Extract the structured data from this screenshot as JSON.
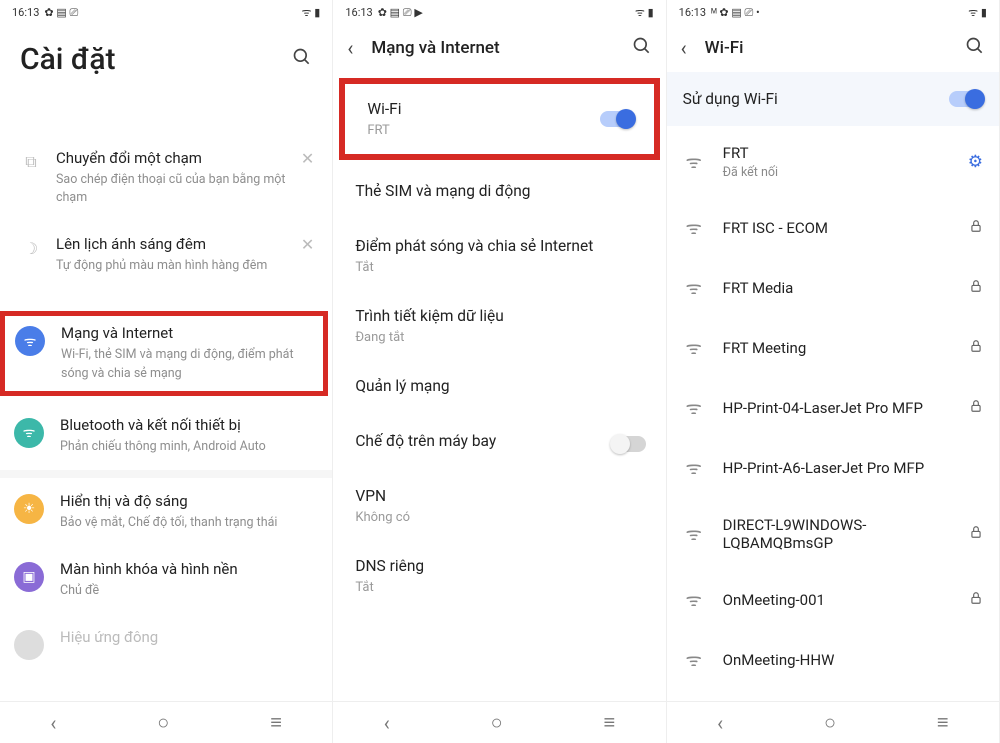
{
  "status": {
    "time": "16:13",
    "icons_p1": "✿ ▤ ⎚",
    "icons_p2": "✿ ▤ ⎚ ▶",
    "icons_p3": "ᴹ ✿ ▤ ⎚ •",
    "right": "ᯤ ▮"
  },
  "panel1": {
    "title": "Cài đặt",
    "card_rows": [
      {
        "icon": "⧉",
        "title": "Chuyển đổi một chạm",
        "sub": "Sao chép điện thoại cũ của bạn bằng một chạm"
      },
      {
        "icon": "☽",
        "title": "Lên lịch ánh sáng đêm",
        "sub": "Tự động phủ màu màn hình hàng đêm"
      }
    ],
    "highlight": {
      "title": "Mạng và Internet",
      "sub": "Wi-Fi, thẻ SIM và mạng di động, điểm phát sóng và chia sẻ mạng"
    },
    "rows": [
      {
        "color": "icon-teal",
        "glyph": "ᯤ",
        "title": "Bluetooth và kết nối thiết bị",
        "sub": "Phản chiếu thông minh, Android Auto"
      },
      {
        "color": "icon-orange",
        "glyph": "☀",
        "title": "Hiển thị và độ sáng",
        "sub": "Bảo vệ mắt, Chế độ tối, thanh trạng thái"
      },
      {
        "color": "icon-purple",
        "glyph": "▣",
        "title": "Màn hình khóa và hình nền",
        "sub": "Chủ đề"
      }
    ],
    "rowExtra": "Hiệu ứng đông"
  },
  "panel2": {
    "headerTitle": "Mạng và Internet",
    "highlight": {
      "title": "Wi-Fi",
      "sub": "FRT"
    },
    "rows": [
      {
        "title": "Thẻ SIM và mạng di động",
        "sub": ""
      },
      {
        "title": "Điểm phát sóng và chia sẻ Internet",
        "sub": "Tắt"
      },
      {
        "title": "Trình tiết kiệm dữ liệu",
        "sub": "Đang tắt"
      },
      {
        "title": "Quản lý mạng",
        "sub": ""
      },
      {
        "title": "Chế độ trên máy bay",
        "sub": "",
        "toggle": "off"
      },
      {
        "title": "VPN",
        "sub": "Không có"
      },
      {
        "title": "DNS riêng",
        "sub": "Tắt"
      }
    ]
  },
  "panel3": {
    "headerTitle": "Wi-Fi",
    "useWifi": "Sử dụng Wi-Fi",
    "networks": [
      {
        "name": "FRT",
        "sub": "Đã kết nối",
        "trailing": "gear"
      },
      {
        "name": "FRT ISC - ECOM",
        "trailing": "lock"
      },
      {
        "name": "FRT Media",
        "trailing": "lock"
      },
      {
        "name": "FRT Meeting",
        "trailing": "lock"
      },
      {
        "name": "HP-Print-04-LaserJet Pro MFP",
        "trailing": "lock"
      },
      {
        "name": "HP-Print-A6-LaserJet Pro MFP",
        "trailing": ""
      },
      {
        "name": "DIRECT-L9WINDOWS-LQBAMQBmsGP",
        "trailing": "lock"
      },
      {
        "name": "OnMeeting-001",
        "trailing": "lock"
      },
      {
        "name": "OnMeeting-HHW",
        "trailing": ""
      }
    ]
  }
}
